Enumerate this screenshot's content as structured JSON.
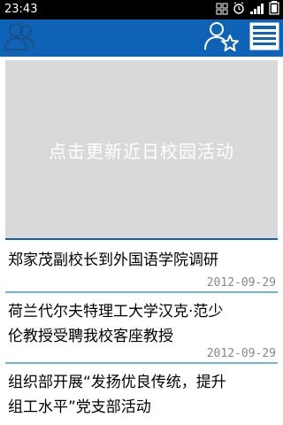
{
  "status_bar": {
    "time": "23:43",
    "icons": [
      "grid-icon",
      "alarm-icon",
      "signal-icon",
      "battery-icon"
    ]
  },
  "header": {
    "left_icon": "people-icon",
    "right_icons": [
      "user-star-icon",
      "news-menu-icon"
    ],
    "colors": {
      "primary": "#0f63b6",
      "accent": "#68b8d8"
    }
  },
  "banner": {
    "text": "点击更新近日校园活动"
  },
  "news": [
    {
      "title": "郑家茂副校长到外国语学院调研",
      "date": "2012-09-29"
    },
    {
      "title_line1": "荷兰代尔夫特理工大学汉克·范少",
      "title_line2": "伦教授受聘我校客座教授",
      "date": "2012-09-29"
    },
    {
      "title_line1": "组织部开展“发扬优良传统，提升",
      "title_line2": "组工水平”党支部活动"
    }
  ]
}
